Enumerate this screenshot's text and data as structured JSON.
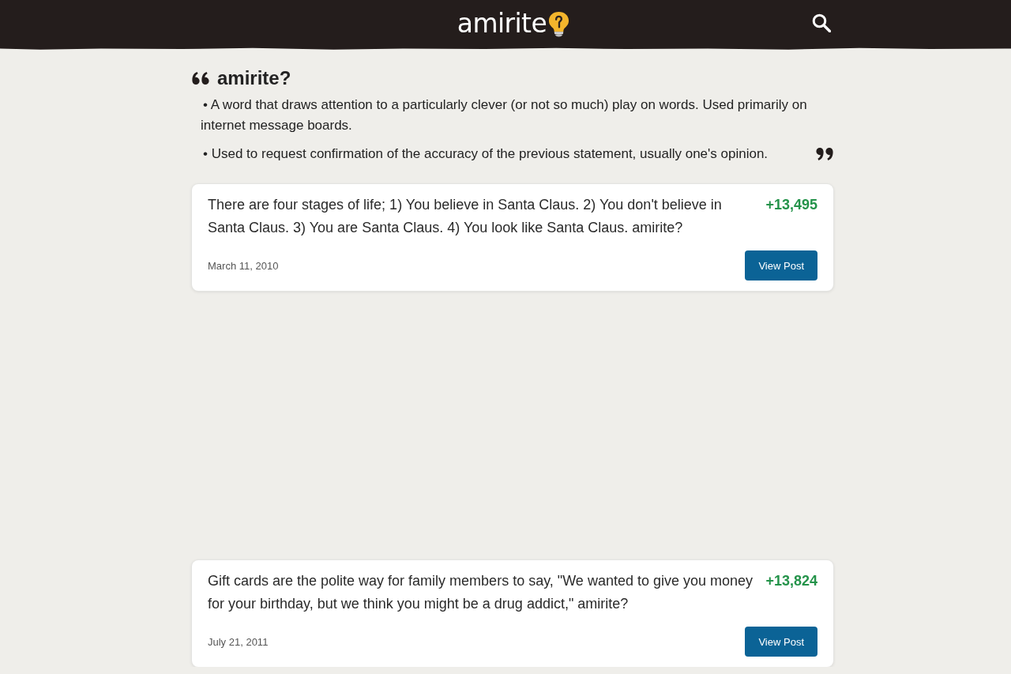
{
  "header": {
    "logo": "amirite"
  },
  "definition": {
    "term": "amirite?",
    "senses": [
      "• A word that draws attention to a particularly clever (or not so much) play on words. Used primarily on internet message boards.",
      "• Used to request confirmation of the accuracy of the previous statement, usually one's opinion."
    ]
  },
  "posts": [
    {
      "text": "There are four stages of life; 1) You believe in Santa Claus. 2) You don't believe in Santa Claus. 3) You are Santa Claus. 4) You look like Santa Claus. amirite?",
      "score": "+13,495",
      "date": "March 11, 2010",
      "button": "View Post"
    },
    {
      "text": "Gift cards are the polite way for family members to say, \"We wanted to give you money for your birthday, but we think you might be a drug addict,\" amirite?",
      "score": "+13,824",
      "date": "July 21, 2011",
      "button": "View Post"
    }
  ]
}
